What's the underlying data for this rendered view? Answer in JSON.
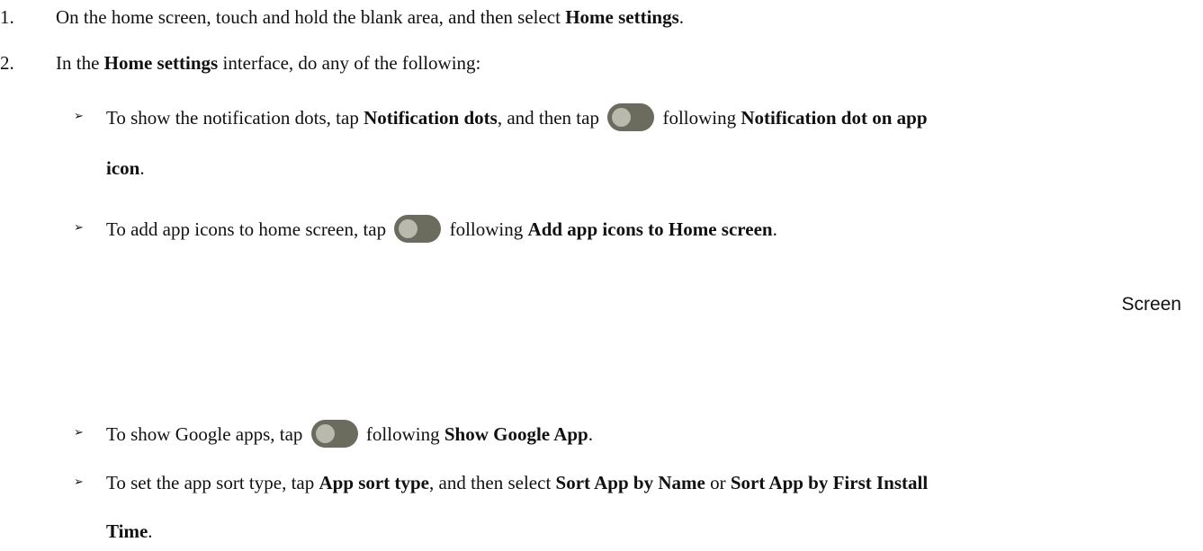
{
  "steps": [
    {
      "num": "1.",
      "t1": "On the home screen, touch and hold the blank area, and then select ",
      "b1": "Home settings",
      "t2": "."
    },
    {
      "num": "2.",
      "t1": "In the ",
      "b1": "Home settings",
      "t2": " interface, do any of the following:"
    }
  ],
  "bullet_glyph": "➢",
  "bullets": {
    "notification": {
      "t1": "To show the notification dots, tap ",
      "b1": "Notification dots",
      "t2": ", and then tap ",
      "t3": " following ",
      "b2": "Notification dot on app",
      "b3": "icon",
      "t4": "."
    },
    "add_icons": {
      "t1": "To add app icons to home screen, tap ",
      "t2": " following ",
      "b1": "Add app icons to Home screen",
      "t3": "."
    },
    "google": {
      "t1": "To show Google apps, tap ",
      "t2": " following ",
      "b1": "Show Google App",
      "t3": "."
    },
    "sort": {
      "t1": "To set the app sort type, tap ",
      "b1": "App sort type",
      "t2": ", and then select ",
      "b2": "Sort App by Name",
      "t3": " or ",
      "b3": "Sort App by First Install",
      "b4": "Time",
      "t4": "."
    }
  },
  "screen_label": "Screen",
  "toggle_icon": "toggle-switch-off-icon",
  "colors": {
    "toggle_track": "#6b6b5e",
    "toggle_knob": "#b9b9ad"
  }
}
